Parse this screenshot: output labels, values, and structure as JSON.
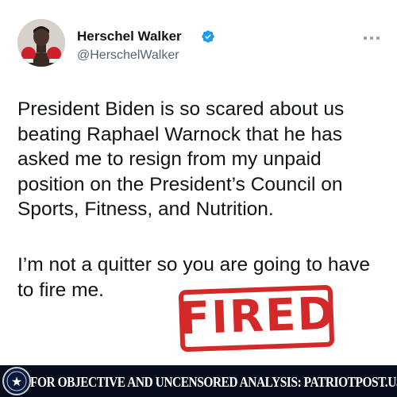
{
  "tweet": {
    "author": {
      "display_name": "Herschel Walker",
      "handle": "@HerschelWalker",
      "verified": true,
      "avatar_icon": "boxer-portrait-avatar"
    },
    "paragraphs": [
      "President Biden is so scared about us beating Raphael Warnock that he has asked me to resign from my unpaid position on the President’s Council on Sports, Fitness, and Nutrition.",
      "I’m not a quitter so you are going to have to fire me."
    ]
  },
  "stamp": {
    "text": "FIRED",
    "color": "#d42929"
  },
  "footer": {
    "text": "FOR OBJECTIVE AND UNCENSORED ANALYSIS: PATRIOTPOST.US",
    "seal_mark": "★",
    "background": "#060c1b"
  },
  "colors": {
    "text": "#0f1419",
    "secondary": "#536471",
    "verified": "#1d9bf0"
  }
}
